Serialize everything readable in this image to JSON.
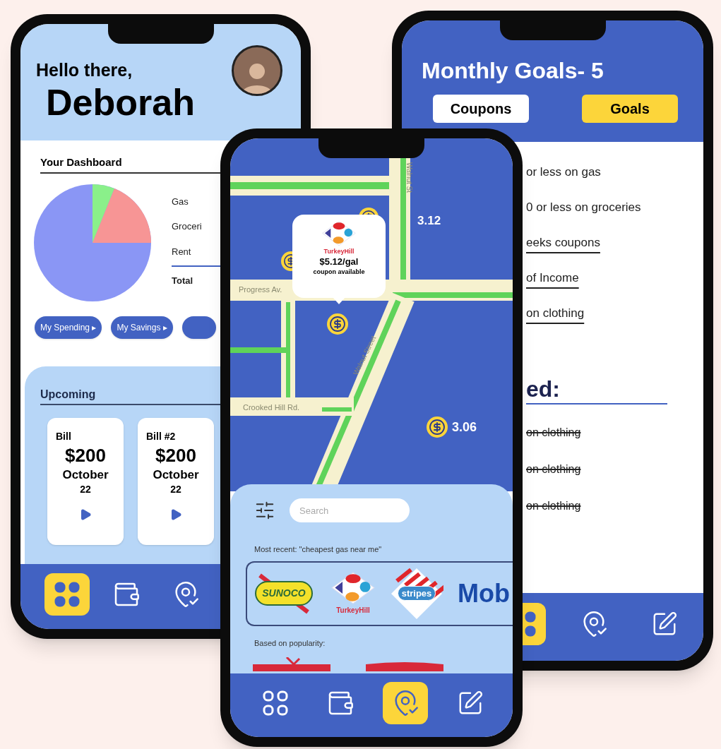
{
  "dashboard_phone": {
    "greeting": "Hello there,",
    "name": "Deborah",
    "dashboard_title": "Your Dashboard",
    "legend": [
      "Gas",
      "Groceri",
      "Rent",
      "Total"
    ],
    "buttons": [
      "My Spending ▸",
      "My Savings ▸"
    ],
    "upcoming_title": "Upcoming",
    "bills": [
      {
        "label": "Bill",
        "amount": "$200",
        "month": "October",
        "day": "22"
      },
      {
        "label": "Bill #2",
        "amount": "$200",
        "month": "October",
        "day": "22"
      }
    ],
    "nav": [
      {
        "kind": "grid",
        "selected": true
      },
      {
        "kind": "wallet",
        "selected": false
      },
      {
        "kind": "pin",
        "selected": false
      }
    ]
  },
  "goals_phone": {
    "title": "Monthly Goals- 5",
    "tabs": [
      {
        "label": "Coupons",
        "selected": false
      },
      {
        "label": "Goals",
        "selected": true
      }
    ],
    "goals": [
      {
        "text": "or less on gas",
        "underlined": false
      },
      {
        "text": "0 or less on groceries",
        "underlined": false
      },
      {
        "text": "eeks coupons",
        "underlined": true
      },
      {
        "text": "of Income",
        "underlined": true
      },
      {
        "text": "on clothing",
        "underlined": true
      }
    ],
    "achieved_title": "ed:",
    "achieved": [
      {
        "text": "on clothing",
        "done": true
      },
      {
        "text": "on clothing",
        "done": true
      },
      {
        "text": "on clothing",
        "done": true
      }
    ],
    "nav": [
      {
        "kind": "grid",
        "selected": true
      },
      {
        "kind": "pin",
        "selected": false
      },
      {
        "kind": "edit",
        "selected": false
      }
    ]
  },
  "map_phone": {
    "streets": [
      "Walnut St",
      "Progress Av.",
      "Walnut Street",
      "Crooked Hill Rd."
    ],
    "popup": {
      "brand": "TurkeyHill",
      "price": "$5.12/gal",
      "note": "coupon available"
    },
    "prices": [
      "3.12",
      "3.06"
    ],
    "search": {
      "placeholder": "Search"
    },
    "recent_label": "Most recent: \"cheapest gas near me\"",
    "recent_logos": [
      {
        "kind": "sunoco",
        "text": "SUNOCO"
      },
      {
        "kind": "turkeyhill",
        "text": "TurkeyHill"
      },
      {
        "kind": "stripes",
        "text": "stripes"
      },
      {
        "kind": "mobil",
        "text": "Mob"
      }
    ],
    "popular_label": "Based on popularity:",
    "nav": [
      {
        "kind": "grid",
        "selected": false
      },
      {
        "kind": "wallet",
        "selected": false
      },
      {
        "kind": "pin",
        "selected": true
      },
      {
        "kind": "edit",
        "selected": false
      }
    ]
  }
}
